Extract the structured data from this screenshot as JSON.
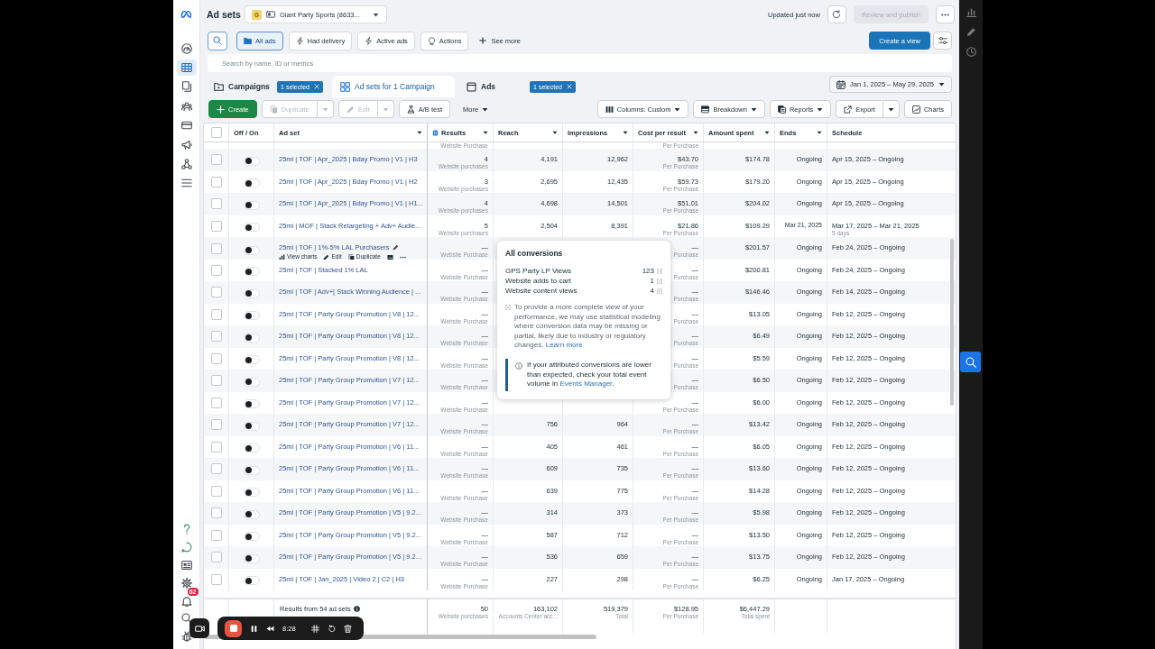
{
  "header": {
    "title": "Ad sets",
    "account": {
      "badge": "G",
      "name": "Giant Party Sports (8633..."
    },
    "status": "Updated just now",
    "publish": {
      "label": "Review and publish",
      "disabled": true
    }
  },
  "sidebar": {
    "top": [
      {
        "kind": "gauge",
        "selected": false
      },
      {
        "kind": "table",
        "selected": true
      },
      {
        "kind": "pages",
        "selected": false
      },
      {
        "kind": "people",
        "selected": false
      },
      {
        "kind": "card",
        "selected": false
      },
      {
        "kind": "megaphone",
        "selected": false
      },
      {
        "kind": "network",
        "selected": false
      },
      {
        "kind": "menu",
        "selected": false
      }
    ],
    "bottom": [
      {
        "kind": "help"
      },
      {
        "kind": "chat"
      },
      {
        "kind": "news"
      },
      {
        "kind": "gear"
      },
      {
        "kind": "bell",
        "badge": "62"
      },
      {
        "kind": "search"
      },
      {
        "kind": "bug"
      }
    ]
  },
  "filters": {
    "chips": [
      {
        "label": "All ads",
        "kind": "all",
        "selected": true
      },
      {
        "label": "Had delivery",
        "kind": "delivery",
        "selected": false
      },
      {
        "label": "Active ads",
        "kind": "active",
        "selected": false
      },
      {
        "label": "Actions",
        "kind": "actions",
        "selected": false
      }
    ],
    "see_more": "See more",
    "create_view": "Create a view"
  },
  "search": {
    "placeholder": "Search by name, ID or metrics"
  },
  "level_tabs": [
    {
      "label": "Campaigns",
      "kind": "campaigns",
      "selected": false,
      "selection": "1 selected"
    },
    {
      "label": "Ad sets for 1 Campaign",
      "kind": "ad_sets",
      "selected": true
    },
    {
      "label": "Ads",
      "kind": "ads",
      "selected": false,
      "selection": "1 selected"
    }
  ],
  "date_range": {
    "label": "Jan 1, 2025 – May 29, 2025"
  },
  "toolbar": {
    "left": [
      {
        "label": "Create",
        "kind": "create",
        "disabled": false
      },
      {
        "label": "Duplicate",
        "kind": "duplicate",
        "disabled": true
      },
      {
        "label": "Edit",
        "kind": "edit",
        "disabled": true
      },
      {
        "label": "A/B test",
        "kind": "ab_test",
        "disabled": false
      },
      {
        "label": "More",
        "kind": "more",
        "disabled": false
      }
    ],
    "right": [
      {
        "label": "Columns: Custom",
        "kind": "columns",
        "disabled": false
      },
      {
        "label": "Breakdown",
        "kind": "breakdown",
        "disabled": false
      },
      {
        "label": "Reports",
        "kind": "reports",
        "disabled": false
      },
      {
        "label": "Export",
        "kind": "export",
        "disabled": false
      },
      {
        "label": "Charts",
        "kind": "charts",
        "disabled": false
      }
    ]
  },
  "table": {
    "all_checked": false,
    "columns": [
      {
        "label": "Off / On",
        "menu": false,
        "handle": false
      },
      {
        "label": "Ad set",
        "menu": true,
        "handle": false
      },
      {
        "label": "Results",
        "menu": true,
        "handle": true
      },
      {
        "label": "Reach",
        "menu": true,
        "handle": false
      },
      {
        "label": "Impressions",
        "menu": true,
        "handle": false
      },
      {
        "label": "Cost per result",
        "menu": true,
        "handle": false
      },
      {
        "label": "Amount spent",
        "menu": true,
        "handle": false
      },
      {
        "label": "Ends",
        "menu": true,
        "handle": false
      },
      {
        "label": "Schedule",
        "menu": false,
        "handle": false
      }
    ],
    "rows": [
      {
        "kind": "partial",
        "results_label": "Website Purchase",
        "cost_label": "Per Purchase"
      },
      {
        "kind": "full",
        "checked": false,
        "on": false,
        "name": "25mi | TOF | Apr_2025 | Bday Promo | V1 | H3",
        "results": "4",
        "results_label": "Website purchases",
        "reach": "4,191",
        "impressions": "12,962",
        "cost": "$43.70",
        "cost_label": "Per Purchase",
        "amount_spent": "$174.78",
        "ends": "Ongoing",
        "schedule": "Apr 15, 2025 – Ongoing"
      },
      {
        "kind": "full",
        "checked": false,
        "on": false,
        "name": "25mi | TOF | Apr_2025 | Bday Promo | V1 | H2",
        "results": "3",
        "results_label": "Website purchases",
        "reach": "2,695",
        "impressions": "12,435",
        "cost": "$59.73",
        "cost_label": "Per Purchase",
        "amount_spent": "$179.20",
        "ends": "Ongoing",
        "schedule": "Apr 15, 2025 – Ongoing"
      },
      {
        "kind": "full",
        "checked": false,
        "on": false,
        "name": "25mi | TOF | Apr_2025 | Bday Promo | V1 | H1...",
        "results": "4",
        "results_label": "Website purchases",
        "reach": "4,698",
        "impressions": "14,501",
        "cost": "$51.01",
        "cost_label": "Per Purchase",
        "amount_spent": "$204.02",
        "ends": "Ongoing",
        "schedule": "Apr 15, 2025 – Ongoing"
      },
      {
        "kind": "full",
        "checked": false,
        "on": false,
        "name": "25mi | MOF | Stack Retargeting + Adv+ Audie...",
        "results": "5",
        "results_label": "Website purchases",
        "reach": "2,504",
        "impressions": "8,391",
        "cost": "$21.86",
        "cost_label": "Per Purchase",
        "amount_spent": "$109.29",
        "ends_date": "Mar 21, 2025",
        "schedule": "Mar 17, 2025 – Mar 21, 2025",
        "schedule_note": "5 days"
      },
      {
        "kind": "full",
        "checked": false,
        "on": false,
        "name": "25mi | TOF | 1%-5% LAL Purchasers",
        "actions": [
          {
            "label": "View charts",
            "kind": "charts"
          },
          {
            "label": "Edit",
            "kind": "edit"
          },
          {
            "label": "Duplicate",
            "kind": "duplicate"
          },
          {
            "kind": "preview"
          },
          {
            "kind": "more"
          }
        ],
        "results": "—",
        "results_label": "Website Purchase",
        "cost": "—",
        "cost_label": "Purchase",
        "amount_spent": "$201.57",
        "ends": "Ongoing",
        "schedule": "Feb 24, 2025 – Ongoing"
      },
      {
        "kind": "full",
        "checked": false,
        "on": false,
        "name": "25mi | TOF | Stacked 1% LAL",
        "results": "—",
        "results_label": "Website Purchase",
        "cost": "—",
        "cost_label": "Purchase",
        "amount_spent": "$200.81",
        "ends": "Ongoing",
        "schedule": "Feb 24, 2025 – Ongoing"
      },
      {
        "kind": "full",
        "checked": false,
        "on": false,
        "name": "25mi | TOF | Adv+| Stack Winning Audience | ...",
        "results": "—",
        "results_label": "Website Purchase",
        "cost": "—",
        "cost_label": "Purchase",
        "amount_spent": "$146.46",
        "ends": "Ongoing",
        "schedule": "Feb 14, 2025 – Ongoing"
      },
      {
        "kind": "full",
        "checked": false,
        "on": false,
        "name": "25mi | TOF | Party Group Promotion | V8 | 12...",
        "results": "—",
        "results_label": "Website Purchase",
        "cost": "—",
        "cost_label": "Purchase",
        "amount_spent": "$13.05",
        "ends": "Ongoing",
        "schedule": "Feb 12, 2025 – Ongoing"
      },
      {
        "kind": "full",
        "checked": false,
        "on": false,
        "name": "25mi | TOF | Party Group Promotion | V8 | 12...",
        "results": "—",
        "results_label": "Website Purchase",
        "cost": "—",
        "cost_label": "Purchase",
        "amount_spent": "$6.49",
        "ends": "Ongoing",
        "schedule": "Feb 12, 2025 – Ongoing"
      },
      {
        "kind": "full",
        "checked": false,
        "on": false,
        "name": "25mi | TOF | Party Group Promotion | V8 | 12...",
        "results": "—",
        "results_label": "Website Purchase",
        "cost": "—",
        "cost_label": "Purchase",
        "amount_spent": "$5.59",
        "ends": "Ongoing",
        "schedule": "Feb 12, 2025 – Ongoing"
      },
      {
        "kind": "full",
        "checked": false,
        "on": false,
        "name": "25mi | TOF | Party Group Promotion | V7 | 12...",
        "results": "—",
        "results_label": "Website Purchase",
        "cost": "—",
        "cost_label": "Purchase",
        "amount_spent": "$6.50",
        "ends": "Ongoing",
        "schedule": "Feb 12, 2025 – Ongoing"
      },
      {
        "kind": "full",
        "checked": false,
        "on": false,
        "name": "25mi | TOF | Party Group Promotion | V7 | 12...",
        "results": "—",
        "results_label": "Website Purchase",
        "cost": "—",
        "cost_label": "Per Purchase",
        "amount_spent": "$6.00",
        "ends": "Ongoing",
        "schedule": "Feb 12, 2025 – Ongoing"
      },
      {
        "kind": "full",
        "checked": false,
        "on": false,
        "name": "25mi | TOF | Party Group Promotion | V7 | 12...",
        "results": "—",
        "results_label": "Website Purchase",
        "reach": "756",
        "impressions": "964",
        "cost": "—",
        "cost_label": "Per Purchase",
        "amount_spent": "$13.42",
        "ends": "Ongoing",
        "schedule": "Feb 12, 2025 – Ongoing"
      },
      {
        "kind": "full",
        "checked": false,
        "on": false,
        "name": "25mi | TOF | Party Group Promotion | V6 | 11...",
        "results": "—",
        "results_label": "Website Purchase",
        "reach": "405",
        "impressions": "461",
        "cost": "—",
        "cost_label": "Per Purchase",
        "amount_spent": "$6.05",
        "ends": "Ongoing",
        "schedule": "Feb 12, 2025 – Ongoing"
      },
      {
        "kind": "full",
        "checked": false,
        "on": false,
        "name": "25mi | TOF | Party Group Promotion | V6 | 11...",
        "results": "—",
        "results_label": "Website Purchase",
        "reach": "609",
        "impressions": "735",
        "cost": "—",
        "cost_label": "Per Purchase",
        "amount_spent": "$13.60",
        "ends": "Ongoing",
        "schedule": "Feb 12, 2025 – Ongoing"
      },
      {
        "kind": "full",
        "checked": false,
        "on": false,
        "name": "25mi | TOF | Party Group Promotion | V6 | 11...",
        "results": "—",
        "results_label": "Website Purchase",
        "reach": "639",
        "impressions": "775",
        "cost": "—",
        "cost_label": "Per Purchase",
        "amount_spent": "$14.28",
        "ends": "Ongoing",
        "schedule": "Feb 12, 2025 – Ongoing"
      },
      {
        "kind": "full",
        "checked": false,
        "on": false,
        "name": "25mi | TOF | Party Group Promotion | V5 | 9.2...",
        "results": "—",
        "results_label": "Website Purchase",
        "reach": "314",
        "impressions": "373",
        "cost": "—",
        "cost_label": "Per Purchase",
        "amount_spent": "$5.98",
        "ends": "Ongoing",
        "schedule": "Feb 12, 2025 – Ongoing"
      },
      {
        "kind": "full",
        "checked": false,
        "on": false,
        "name": "25mi | TOF | Party Group Promotion | V5 | 9.2...",
        "results": "—",
        "results_label": "Website Purchase",
        "reach": "587",
        "impressions": "712",
        "cost": "—",
        "cost_label": "Per Purchase",
        "amount_spent": "$13.50",
        "ends": "Ongoing",
        "schedule": "Feb 12, 2025 – Ongoing"
      },
      {
        "kind": "full",
        "checked": false,
        "on": false,
        "name": "25mi | TOF | Party Group Promotion | V5 | 9.2...",
        "results": "—",
        "results_label": "Website Purchase",
        "reach": "536",
        "impressions": "659",
        "cost": "—",
        "cost_label": "Per Purchase",
        "amount_spent": "$13.75",
        "ends": "Ongoing",
        "schedule": "Feb 12, 2025 – Ongoing"
      },
      {
        "kind": "full",
        "checked": false,
        "on": false,
        "name": "25mi | TOF | Jan_2025 | Video 2 | C2 | H3",
        "results": "—",
        "results_label": "Website Purchase",
        "reach": "227",
        "impressions": "298",
        "cost": "—",
        "cost_label": "Per Purchase",
        "amount_spent": "$6.25",
        "ends": "Ongoing",
        "schedule": "Jan 17, 2025 – Ongoing"
      }
    ],
    "footer": {
      "label": "Results from 54 ad sets",
      "results": "50",
      "results_label": "Website purchases",
      "reach": "163,102",
      "reach_label": "Accounts Center acc...",
      "impressions": "519,379",
      "impressions_label": "Total",
      "cost": "$128.95",
      "cost_label": "Per Purchase",
      "amount_spent": "$6,447.29",
      "amount_spent_label": "Total spent"
    }
  },
  "tooltip": {
    "title": "All conversions",
    "items": [
      {
        "label": "GPS Party LP Views",
        "value": "123"
      },
      {
        "label": "Website adds to cart",
        "value": "1"
      },
      {
        "label": "Website content views",
        "value": "4"
      }
    ],
    "note": "To provide a more complete view of your performance, we may use statistical modeling where conversion data may be missing or partial, likely due to industry or regulatory changes.",
    "note_link": "Learn more",
    "notice": "If your attributed conversions are lower than expected, check your total event volume in",
    "notice_link": "Events Manager",
    "notice_end": "."
  },
  "recorder": {
    "time": "8:28"
  }
}
